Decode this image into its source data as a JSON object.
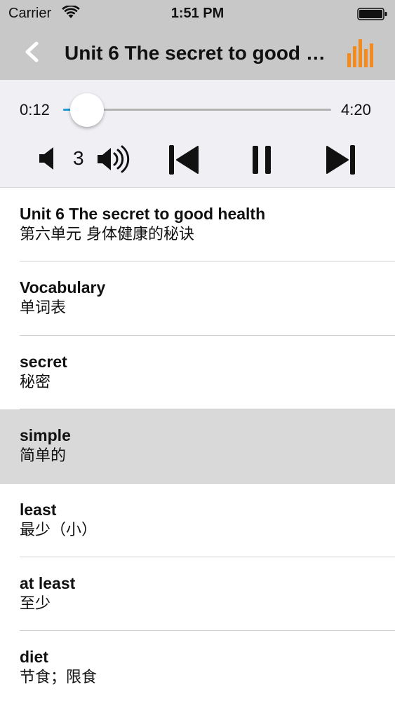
{
  "status_bar": {
    "carrier": "Carrier",
    "time": "1:51 PM",
    "icons": [
      "wifi-icon",
      "battery-icon"
    ]
  },
  "nav": {
    "title": "Unit 6 The secret to good health",
    "back_icon": "chevron-left-icon",
    "right_icon": "equalizer-icon",
    "accent_color": "#f28a1c"
  },
  "player": {
    "current_time": "0:12",
    "total_time": "4:20",
    "progress": 0.046,
    "progress_color": "#1d9bd8",
    "volume": "3",
    "controls": [
      "volume-down-icon",
      "volume-up-icon",
      "previous-track-icon",
      "pause-icon",
      "next-track-icon"
    ]
  },
  "list": {
    "items": [
      {
        "en": "Unit 6 The secret to good health",
        "zh": "第六单元 身体健康的秘诀",
        "selected": false
      },
      {
        "en": "Vocabulary",
        "zh": "单词表",
        "selected": false
      },
      {
        "en": "secret",
        "zh": "秘密",
        "selected": false
      },
      {
        "en": "simple",
        "zh": "简单的",
        "selected": true
      },
      {
        "en": "least",
        "zh": "最少（小）",
        "selected": false
      },
      {
        "en": "at least",
        "zh": "至少",
        "selected": false
      },
      {
        "en": "diet",
        "zh": "节食；限食",
        "selected": false
      }
    ]
  }
}
